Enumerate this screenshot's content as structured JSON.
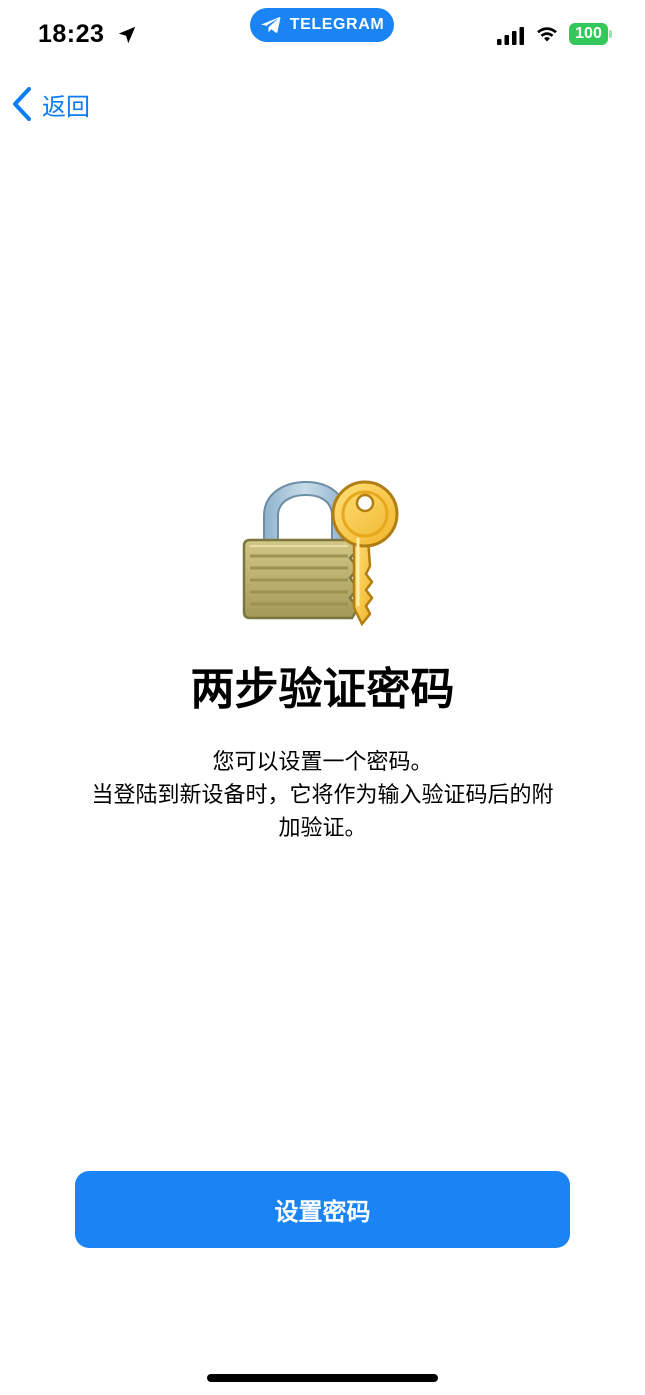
{
  "status_bar": {
    "time": "18:23",
    "app_pill": {
      "label": "TELEGRAM",
      "color": "#1a84f5"
    },
    "battery": "100",
    "battery_color": "#34c759",
    "icons": [
      "location-arrow-icon",
      "telegram-icon",
      "cellular-signal-icon",
      "wifi-icon",
      "battery-icon"
    ]
  },
  "nav": {
    "back_label": "返回",
    "accent_color": "#0a7df7"
  },
  "illustration": {
    "icon": "lock-with-key-icon"
  },
  "content": {
    "title": "两步验证密码",
    "description_lines": [
      "您可以设置一个密码。",
      "当登陆到新设备时，它将作为输入验证码后的附",
      "加验证。"
    ]
  },
  "button": {
    "label": "设置密码",
    "color": "#1a84f5"
  }
}
